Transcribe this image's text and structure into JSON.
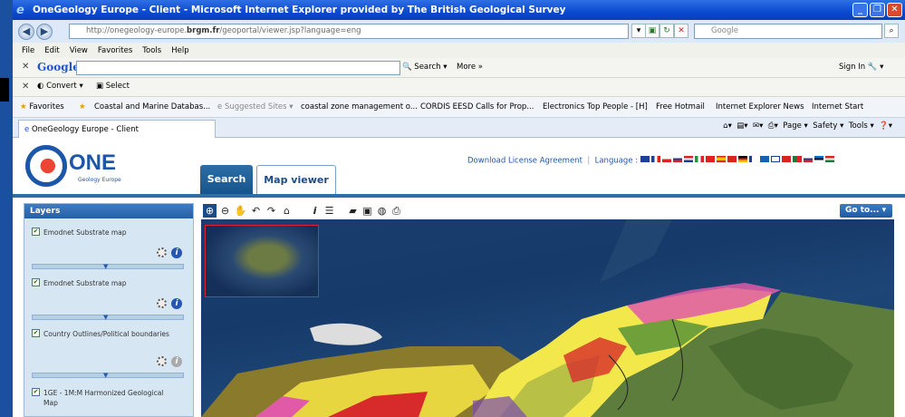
{
  "window": {
    "title": "OneGeology Europe - Client - Microsoft Internet Explorer provided by The British Geological Survey"
  },
  "address": {
    "url_prefix": "http://onegeology-europe.",
    "url_domain": "brgm.fr",
    "url_rest": "/geoportal/viewer.jsp?language=eng",
    "search_placeholder": "Google"
  },
  "menu": [
    "File",
    "Edit",
    "View",
    "Favorites",
    "Tools",
    "Help"
  ],
  "google_toolbar": {
    "logo": "Google",
    "search_label": "Search",
    "more_label": "More »",
    "signin_label": "Sign In"
  },
  "convert_toolbar": {
    "convert_label": "Convert",
    "select_label": "Select"
  },
  "favorites": {
    "label": "Favorites",
    "items": [
      "Coastal and Marine Databas...",
      "Suggested Sites",
      "coastal zone management o...",
      "CORDIS EESD Calls for Prop...",
      "Electronics Top People - [H]",
      "Free Hotmail",
      "Internet Explorer News",
      "Internet Start"
    ]
  },
  "tab": {
    "title": "OneGeology Europe - Client"
  },
  "command_bar": {
    "page": "Page",
    "safety": "Safety",
    "tools": "Tools"
  },
  "site": {
    "logo_text": "ONE",
    "logo_sub": "Geology  Europe",
    "download_link": "Download License Agreement",
    "language_label": "Language :",
    "tabs": {
      "search": "Search",
      "map_viewer": "Map viewer"
    },
    "goto_label": "Go to...",
    "layers_header": "Layers",
    "layers": [
      {
        "name": "Emodnet Substrate map",
        "checked": true
      },
      {
        "name": "Emodnet Substrate map",
        "checked": true
      },
      {
        "name": "Country Outlines/Political boundaries",
        "checked": true
      },
      {
        "name": "1GE - 1M:M Harmonized Geological Map",
        "checked": true
      }
    ]
  },
  "colors": {
    "titlebar": "#0a4ad0",
    "site_blue": "#2e6ea6",
    "layers_bg": "#d6e6f3",
    "ocean": "#1a3f6e",
    "geology_yellow": "#f2e84c",
    "geology_red": "#d72a2a",
    "geology_pink": "#e05aa8",
    "land_green": "#5c7d3c"
  }
}
